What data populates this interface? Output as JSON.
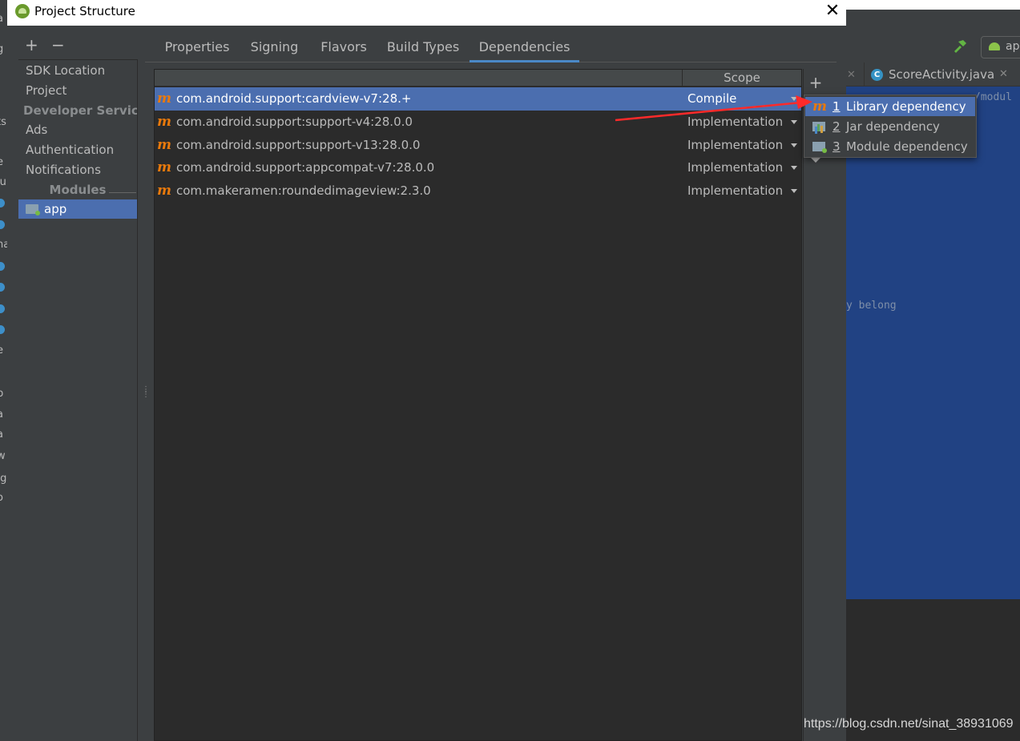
{
  "dialog": {
    "title": "Project Structure",
    "close_glyph": "✕"
  },
  "sidebar": {
    "add_glyph": "+",
    "remove_glyph": "−",
    "items": [
      {
        "label": "SDK Location"
      },
      {
        "label": "Project"
      },
      {
        "label": "Developer Servic..."
      },
      {
        "label": "Ads"
      },
      {
        "label": "Authentication"
      },
      {
        "label": "Notifications"
      },
      {
        "label": "Modules"
      },
      {
        "label": "app"
      }
    ]
  },
  "tabs": [
    {
      "label": "Properties"
    },
    {
      "label": "Signing"
    },
    {
      "label": "Flavors"
    },
    {
      "label": "Build Types"
    },
    {
      "label": "Dependencies",
      "active": true
    }
  ],
  "table": {
    "scope_header": "Scope",
    "rows": [
      {
        "name": "com.android.support:cardview-v7:28.+",
        "scope": "Compile",
        "selected": true
      },
      {
        "name": "com.android.support:support-v4:28.0.0",
        "scope": "Implementation"
      },
      {
        "name": "com.android.support:support-v13:28.0.0",
        "scope": "Implementation"
      },
      {
        "name": "com.android.support:appcompat-v7:28.0.0",
        "scope": "Implementation"
      },
      {
        "name": "com.makeramen:roundedimageview:2.3.0",
        "scope": "Implementation"
      }
    ],
    "maven_glyph": "m"
  },
  "right_toolbar": {
    "add_glyph": "+"
  },
  "popup": {
    "items": [
      {
        "num": "1",
        "label": "Library dependency",
        "icon": "maven-icon",
        "selected": true
      },
      {
        "num": "2",
        "label": "Jar dependency",
        "icon": "jar-folder-icon"
      },
      {
        "num": "3",
        "label": "Module dependency",
        "icon": "module-folder-icon"
      }
    ]
  },
  "background_ide": {
    "run_config": "ap",
    "editor_tab": "ScoreActivity.java",
    "editor_tab_icon": "C",
    "tab_close_glyph": "✕",
    "code_fragment_1": "y belong",
    "code_fragment_2": "/modul",
    "left_strip_chars": [
      "a",
      "g",
      "ts",
      "e",
      "lu",
      "na",
      "e",
      "p",
      "a",
      "a",
      "w",
      ".g",
      "o"
    ]
  },
  "watermark": "https://blog.csdn.net/sinat_38931069",
  "colors": {
    "selection": "#4b6eaf",
    "maven_orange": "#e8790c",
    "annotation_arrow": "#ff2a2a",
    "panel": "#3c3f41",
    "table_bg": "#2b2b2b"
  }
}
